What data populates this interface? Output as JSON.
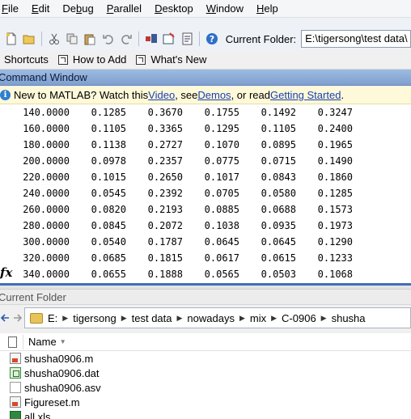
{
  "menu": [
    "File",
    "Edit",
    "Debug",
    "Parallel",
    "Desktop",
    "Window",
    "Help"
  ],
  "menu_underline": [
    "F",
    "E",
    "b",
    "P",
    "D",
    "W",
    "H"
  ],
  "toolbar": {
    "current_folder_label": "Current Folder:",
    "current_folder_value": "E:\\tigersong\\test data\\"
  },
  "shortcuts": {
    "label": "Shortcuts",
    "how_to_add": "How to Add",
    "whats_new": "What's New"
  },
  "command_window": {
    "title": "Command Window",
    "info": {
      "t1": "New to MATLAB? Watch this ",
      "video": "Video",
      "t2": ", see ",
      "demos": "Demos",
      "t3": ", or read ",
      "getting_started": "Getting Started",
      "t4": "."
    },
    "prompt": "fx",
    "rows": [
      [
        "140.0000",
        "0.1285",
        "0.3670",
        "0.1755",
        "0.1492",
        "0.3247"
      ],
      [
        "160.0000",
        "0.1105",
        "0.3365",
        "0.1295",
        "0.1105",
        "0.2400"
      ],
      [
        "180.0000",
        "0.1138",
        "0.2727",
        "0.1070",
        "0.0895",
        "0.1965"
      ],
      [
        "200.0000",
        "0.0978",
        "0.2357",
        "0.0775",
        "0.0715",
        "0.1490"
      ],
      [
        "220.0000",
        "0.1015",
        "0.2650",
        "0.1017",
        "0.0843",
        "0.1860"
      ],
      [
        "240.0000",
        "0.0545",
        "0.2392",
        "0.0705",
        "0.0580",
        "0.1285"
      ],
      [
        "260.0000",
        "0.0820",
        "0.2193",
        "0.0885",
        "0.0688",
        "0.1573"
      ],
      [
        "280.0000",
        "0.0845",
        "0.2072",
        "0.1038",
        "0.0935",
        "0.1973"
      ],
      [
        "300.0000",
        "0.0540",
        "0.1787",
        "0.0645",
        "0.0645",
        "0.1290"
      ],
      [
        "320.0000",
        "0.0685",
        "0.1815",
        "0.0617",
        "0.0615",
        "0.1233"
      ],
      [
        "340.0000",
        "0.0655",
        "0.1888",
        "0.0565",
        "0.0503",
        "0.1068"
      ]
    ]
  },
  "current_folder": {
    "title": "Current Folder",
    "path": [
      "E:",
      "tigersong",
      "test data",
      "nowadays",
      "mix",
      "C-0906",
      "shusha"
    ],
    "column_name": "Name",
    "files": [
      {
        "name": "shusha0906.m",
        "icon": "m-file-icon"
      },
      {
        "name": "shusha0906.dat",
        "icon": "dat-file-icon"
      },
      {
        "name": "shusha0906.asv",
        "icon": "asv-file-icon"
      },
      {
        "name": "Figureset.m",
        "icon": "m-file-icon"
      },
      {
        "name": "all.xls",
        "icon": "xls-file-icon"
      }
    ]
  }
}
